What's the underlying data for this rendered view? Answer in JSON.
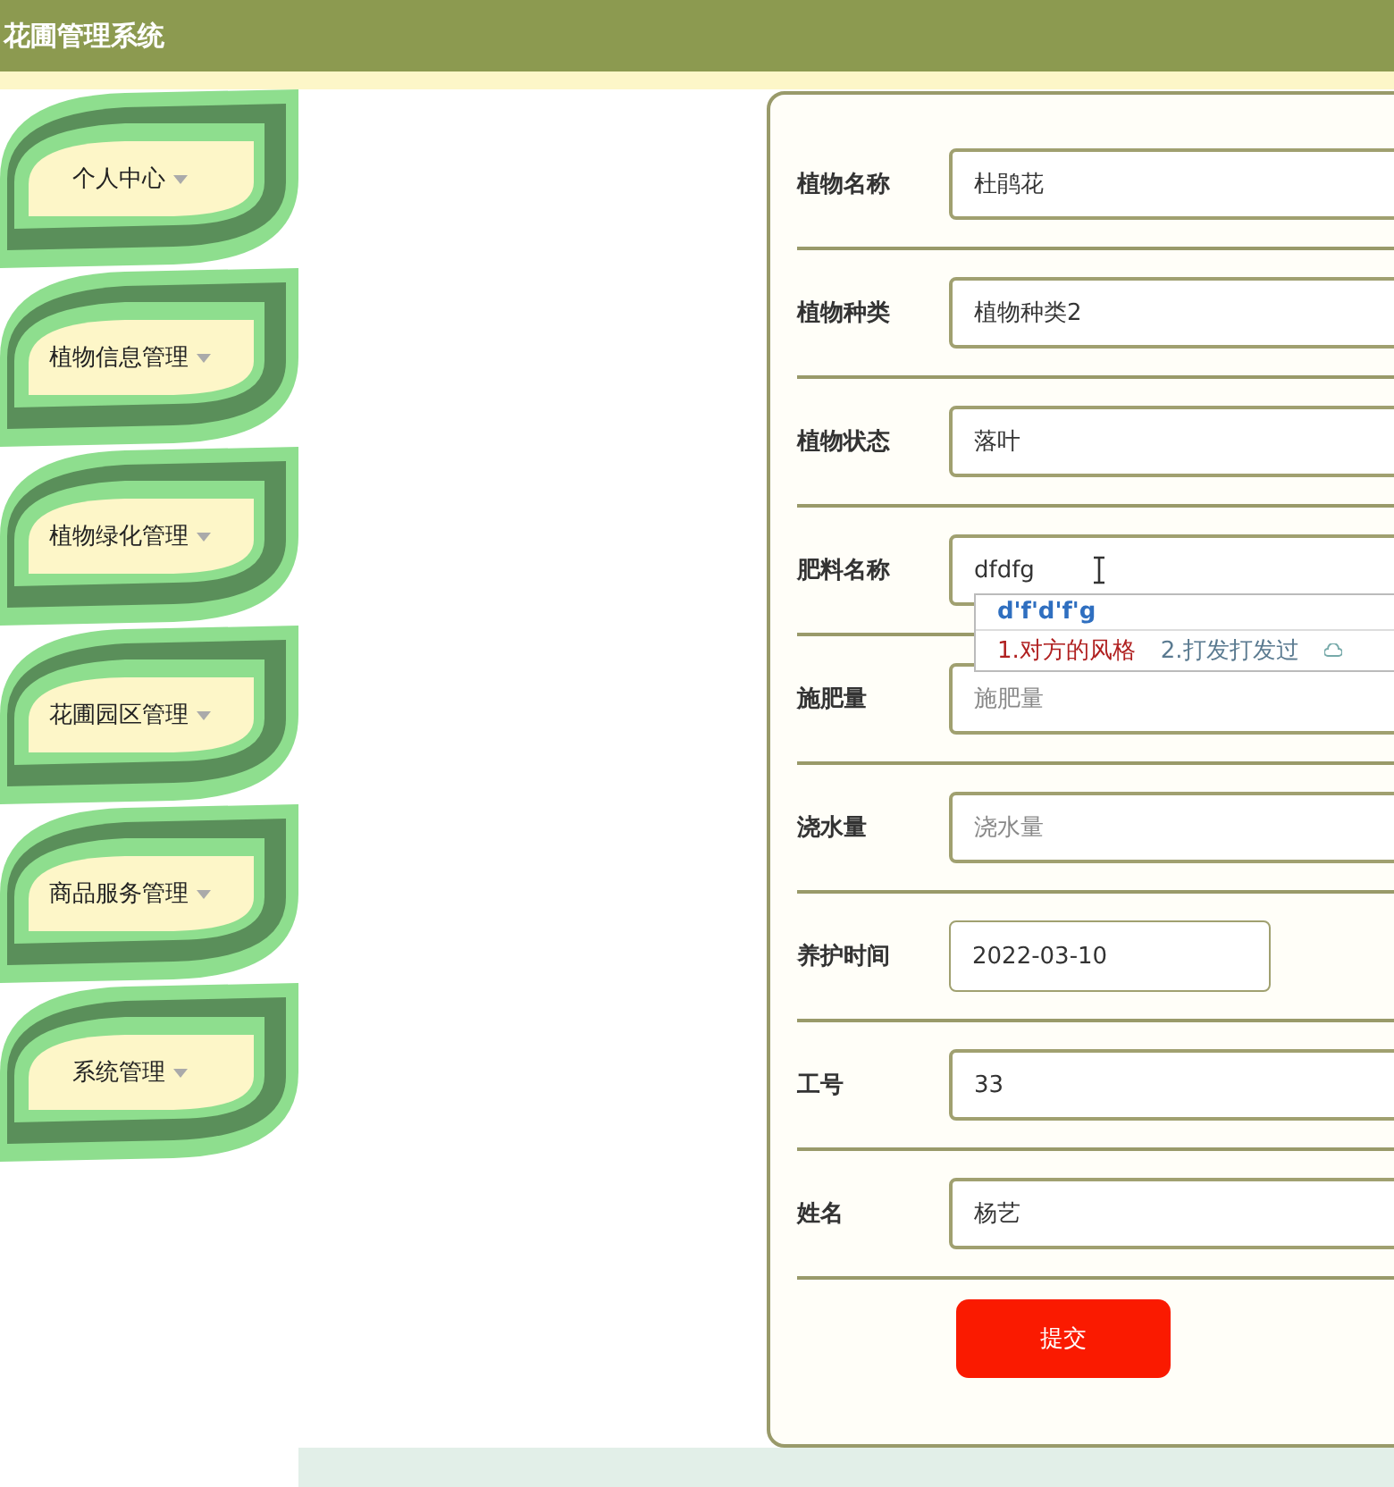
{
  "header": {
    "title": "花圃管理系统"
  },
  "sidebar": {
    "items": [
      {
        "label": "个人中心"
      },
      {
        "label": "植物信息管理"
      },
      {
        "label": "植物绿化管理"
      },
      {
        "label": "花圃园区管理"
      },
      {
        "label": "商品服务管理"
      },
      {
        "label": "系统管理"
      }
    ]
  },
  "form": {
    "fields": [
      {
        "label": "植物名称",
        "kind": "text",
        "value": "杜鹃花"
      },
      {
        "label": "植物种类",
        "kind": "text",
        "value": "植物种类2"
      },
      {
        "label": "植物状态",
        "kind": "text",
        "value": "落叶"
      },
      {
        "label": "肥料名称",
        "kind": "text",
        "value": "dfdfg"
      },
      {
        "label": "施肥量",
        "kind": "text",
        "placeholder": "施肥量"
      },
      {
        "label": "浇水量",
        "kind": "text",
        "placeholder": "浇水量"
      },
      {
        "label": "养护时间",
        "kind": "date",
        "value": "2022-03-10"
      },
      {
        "label": "工号",
        "kind": "text",
        "value": "33"
      },
      {
        "label": "姓名",
        "kind": "text",
        "value": "杨艺"
      }
    ],
    "submit": "提交"
  },
  "ime": {
    "composition": "d'f'd'f'g",
    "candidates": [
      {
        "text": "1.对方的风格",
        "selected": true
      },
      {
        "text": "2.打发打发过",
        "selected": false
      }
    ]
  }
}
